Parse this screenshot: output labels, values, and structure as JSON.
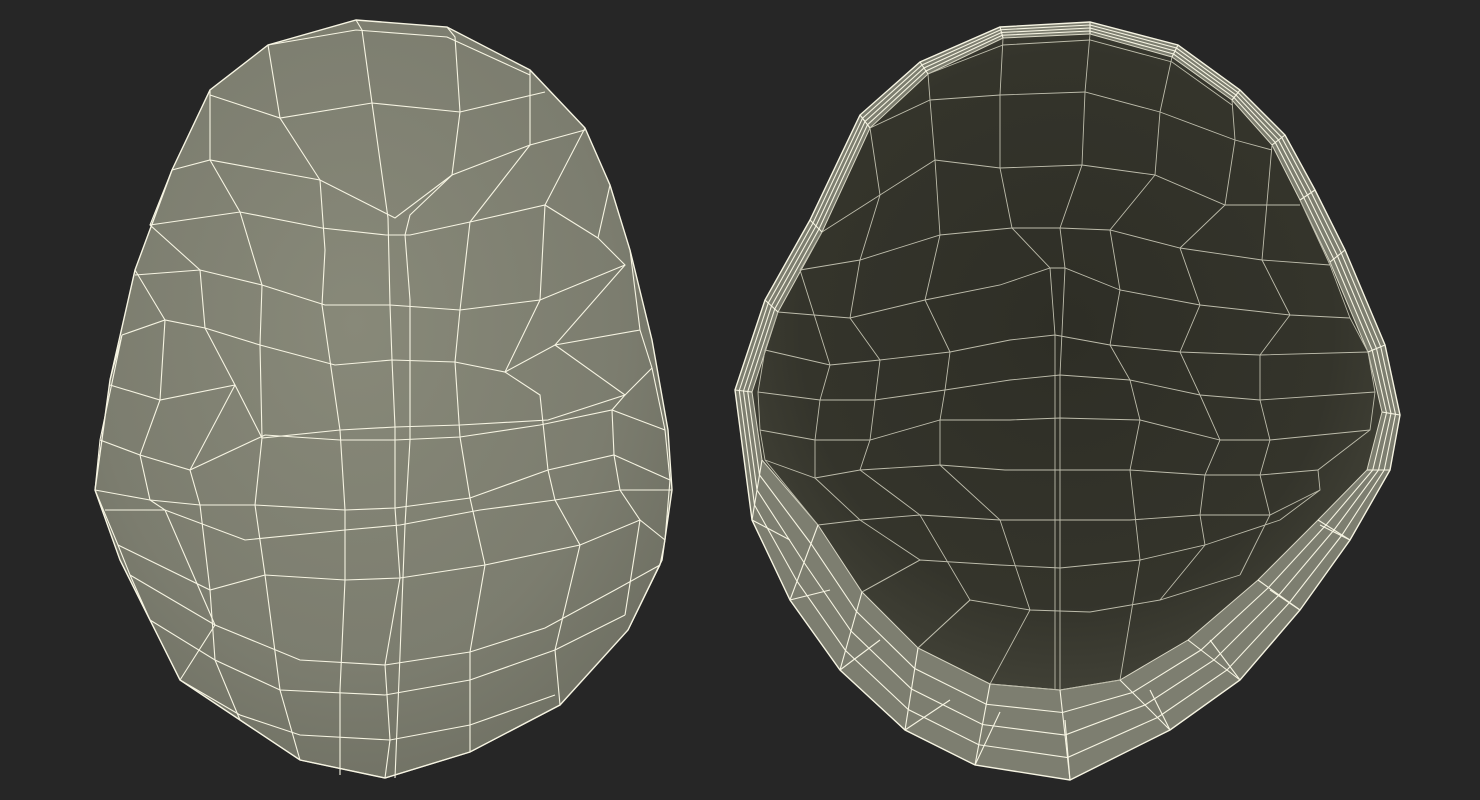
{
  "colors": {
    "background": "#262626",
    "shell_outer": "#7c7d6f",
    "shell_outer_light": "#868779",
    "shell_inner": "#323229",
    "shell_inner_mid": "#3c3c33",
    "wire_outer": "#f6f4e2",
    "wire_inner": "#bdbcab"
  },
  "views": [
    {
      "id": "outer-view",
      "description": "exterior"
    },
    {
      "id": "inner-view",
      "description": "interior"
    }
  ]
}
